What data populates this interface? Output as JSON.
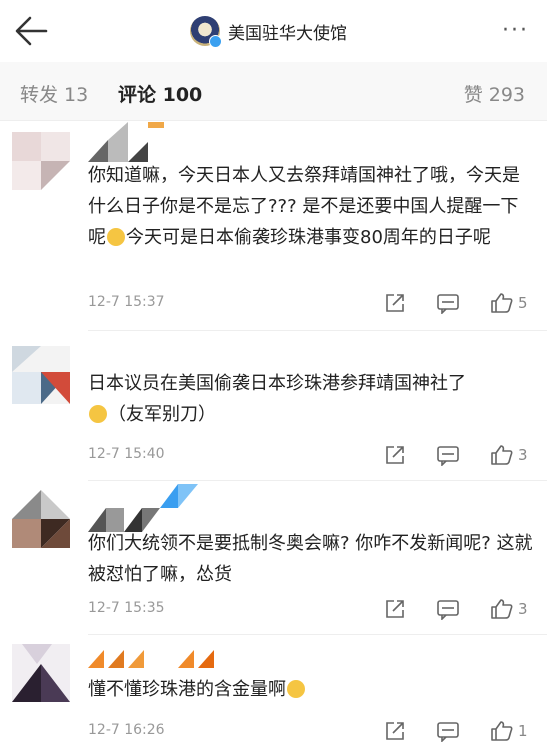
{
  "header": {
    "account_name": "美国驻华大使馆",
    "back_icon": "back-arrow-icon",
    "more_icon": "more-dots-icon"
  },
  "tabs": {
    "repost": "转发 13",
    "comments": "评论 100",
    "likes": "赞 293"
  },
  "comments": [
    {
      "text_a": "你知道嘛，今天日本人又去祭拜靖国神社了哦，今天是什么日子你是不是忘了??? 是不是还要中国人提醒一下呢",
      "text_b": "今天可是日本偷袭珍珠港事变80周年的日子呢",
      "time": "12-7 15:37",
      "likes": "5"
    },
    {
      "text_a": "日本议员在美国偷袭日本珍珠港参拜靖国神社了",
      "text_b": "（友军别刀）",
      "time": "12-7 15:40",
      "likes": "3"
    },
    {
      "text_a": "你们大统领不是要抵制冬奥会嘛? 你咋不发新闻呢? 这就被怼怕了嘛，怂货",
      "time": "12-7 15:35",
      "likes": "3"
    },
    {
      "text_a": "懂不懂珍珠港的含金量啊",
      "time": "12-7 16:26",
      "likes": "1"
    }
  ],
  "colors": {
    "accent_blue": "#3aa0f0",
    "muted_text": "#999999",
    "tab_bg": "#f8f8f8"
  }
}
